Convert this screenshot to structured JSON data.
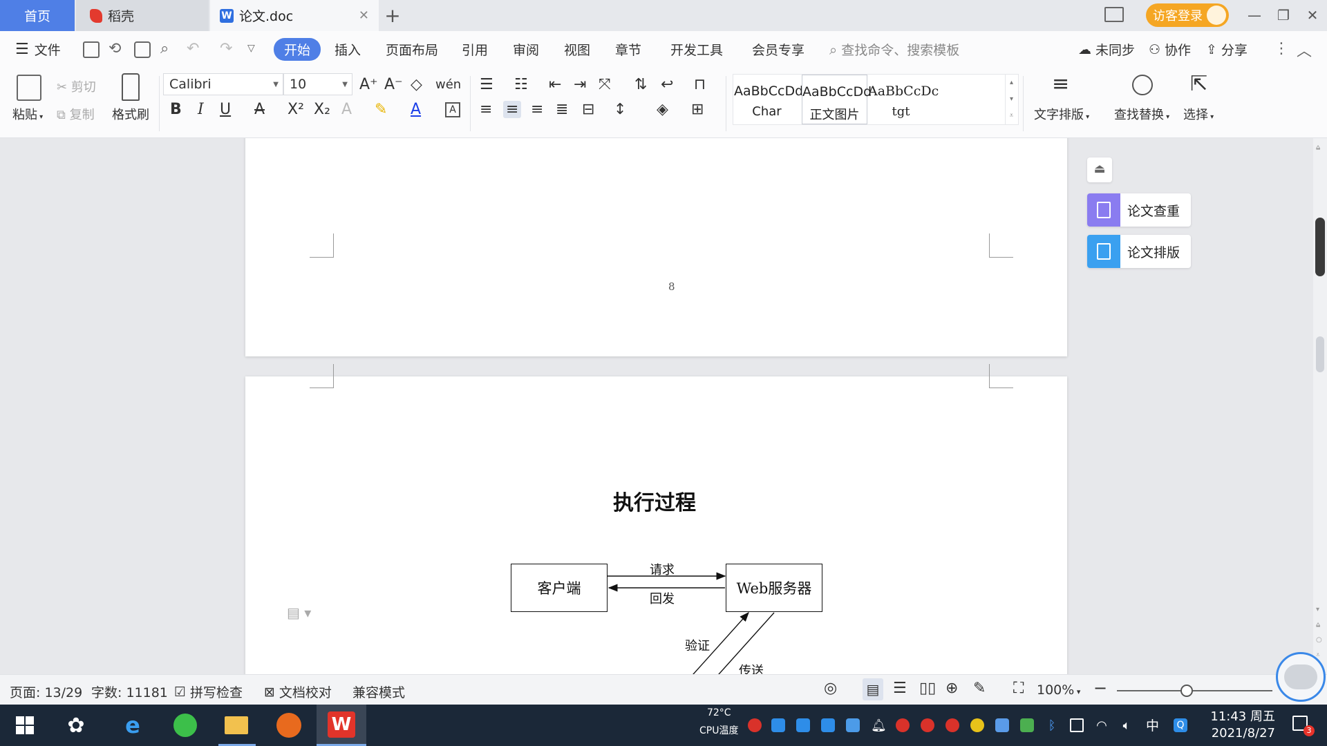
{
  "tabs": {
    "home": "首页",
    "daoke": "稻壳",
    "doc": "论文.doc",
    "plus": "+"
  },
  "window": {
    "login": "访客登录"
  },
  "toolbar": {
    "file": "文件"
  },
  "menus": [
    "开始",
    "插入",
    "页面布局",
    "引用",
    "审阅",
    "视图",
    "章节",
    "开发工具",
    "会员专享"
  ],
  "search": {
    "placeholder": "查找命令、搜索模板"
  },
  "right_menu": {
    "sync": "未同步",
    "collab": "协作",
    "share": "分享"
  },
  "ribbon": {
    "paste": "粘贴",
    "cut": "剪切",
    "copy": "复制",
    "format_painter": "格式刷",
    "font": "Calibri",
    "size": "10",
    "styles": [
      {
        "sample": "AaBbCcDd",
        "name": "Char"
      },
      {
        "sample": "AaBbCcDd",
        "name": "正文图片"
      },
      {
        "sample": "AaBbCcDc",
        "name": "tgt"
      }
    ],
    "text_layout": "文字排版",
    "find_replace": "查找替换",
    "select": "选择"
  },
  "document": {
    "page_number": "8",
    "heading": "执行过程",
    "diagram": {
      "client": "客户端",
      "server": "Web服务器",
      "request": "请求",
      "reply": "回发",
      "verify": "验证",
      "transfer": "传送"
    }
  },
  "side_panel": {
    "check": "论文查重",
    "layout": "论文排版"
  },
  "status": {
    "page": "页面: 13/29",
    "words": "字数: 11181",
    "spell": "拼写检查",
    "proof": "文档校对",
    "compat": "兼容模式",
    "zoom": "100%"
  },
  "taskbar": {
    "cpu_temp": "72°C",
    "cpu_label": "CPU温度",
    "ime": "中",
    "time": "11:43 周五",
    "date": "2021/8/27",
    "notif_count": "3"
  },
  "colors": {
    "accent": "#4f7fe6",
    "login": "#f5a623",
    "check_icon": "#8a7cf0",
    "layout_icon": "#3aa0f0"
  }
}
